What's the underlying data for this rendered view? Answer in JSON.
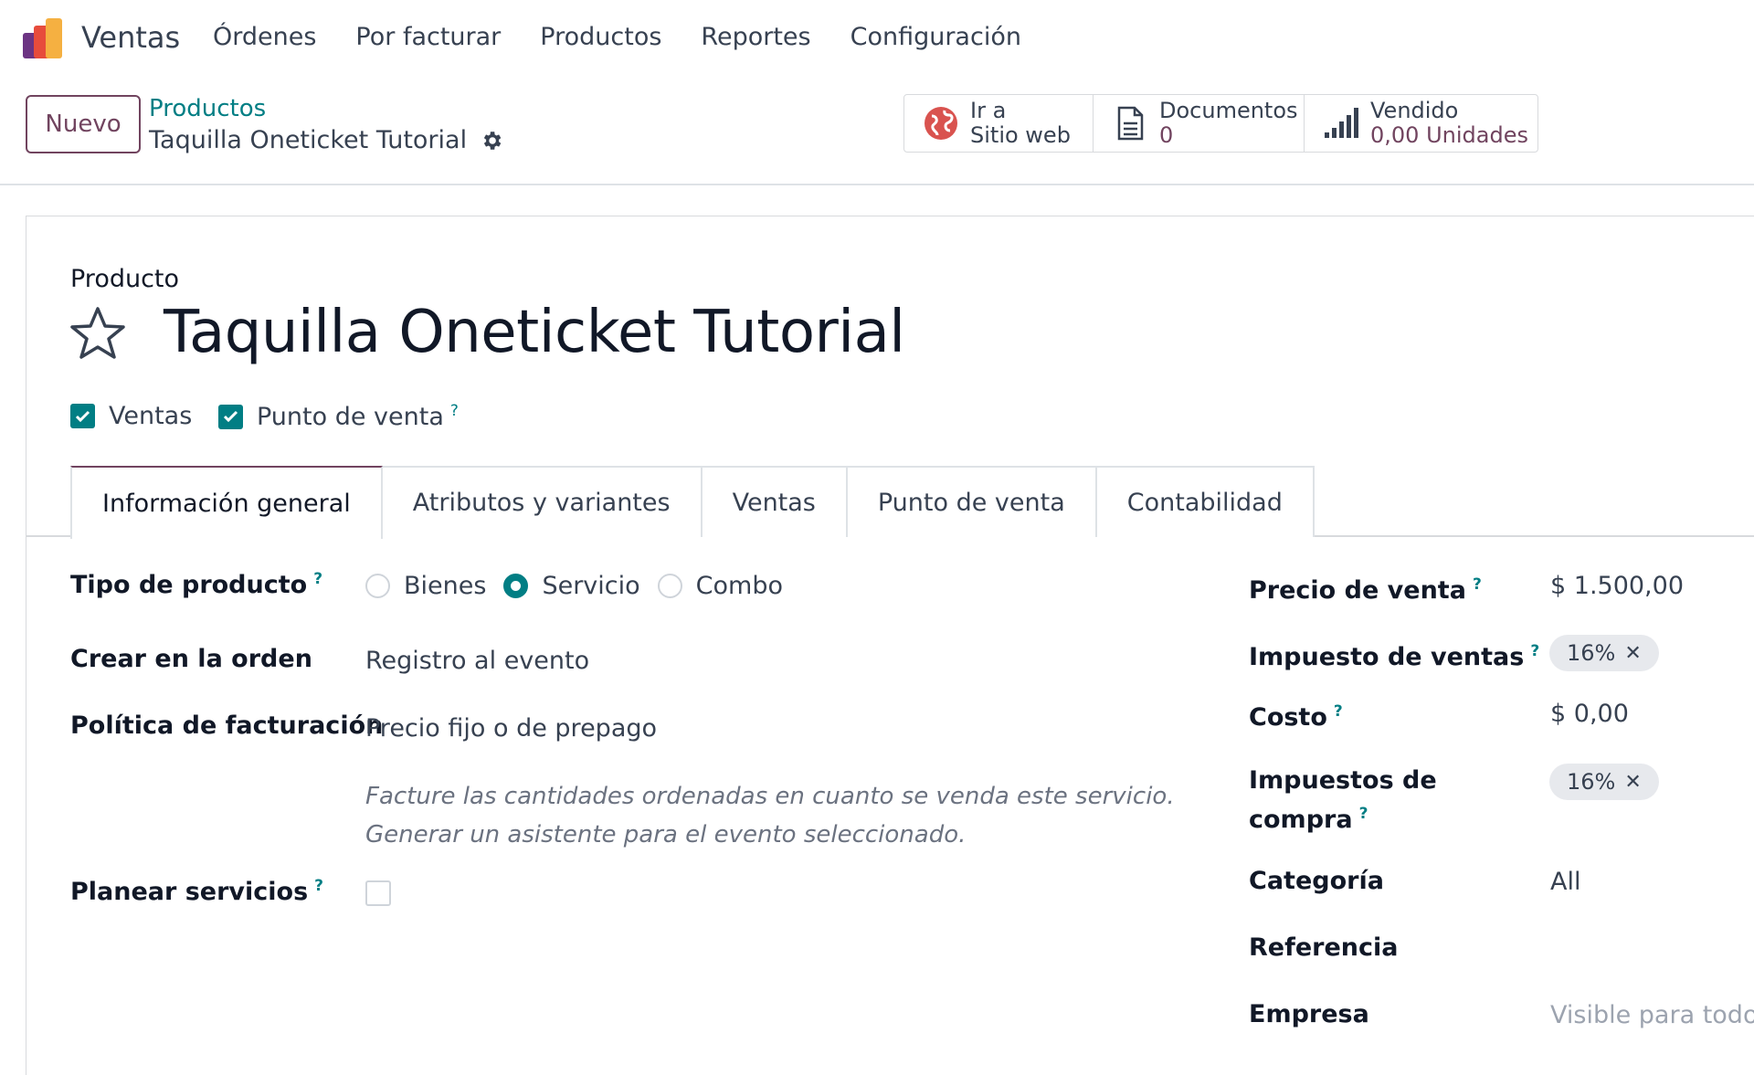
{
  "app": {
    "name": "Ventas"
  },
  "menu": [
    "Órdenes",
    "Por facturar",
    "Productos",
    "Reportes",
    "Configuración"
  ],
  "control": {
    "new_label": "Nuevo",
    "breadcrumb_parent": "Productos",
    "breadcrumb_current": "Taquilla Oneticket Tutorial"
  },
  "smart_buttons": [
    {
      "icon": "globe-icon",
      "line1": "Ir a",
      "line2": "Sitio web"
    },
    {
      "icon": "document-icon",
      "line1": "Documentos",
      "line2": "0"
    },
    {
      "icon": "bar-chart-icon",
      "line1": "Vendido",
      "line2": "0,00 Unidades"
    }
  ],
  "product": {
    "type_label": "Producto",
    "name": "Taquilla Oneticket Tutorial",
    "checkboxes": [
      {
        "label": "Ventas",
        "checked": true,
        "help": ""
      },
      {
        "label": "Punto de venta",
        "checked": true,
        "help": "?"
      }
    ]
  },
  "tabs": [
    "Información general",
    "Atributos y variantes",
    "Ventas",
    "Punto de venta",
    "Contabilidad"
  ],
  "general": {
    "product_type": {
      "label": "Tipo de producto",
      "help": "?",
      "options": [
        "Bienes",
        "Servicio",
        "Combo"
      ],
      "selected": "Servicio"
    },
    "create_on_order": {
      "label": "Crear en la orden",
      "value": "Registro al evento"
    },
    "invoice_policy": {
      "label": "Política de facturación",
      "value": "Precio fijo o de prepago"
    },
    "hint_lines": [
      "Facture las cantidades ordenadas en cuanto se venda este servicio.",
      "Generar un asistente para el evento seleccionado."
    ],
    "plan_services": {
      "label": "Planear servicios",
      "help": "?",
      "checked": false
    }
  },
  "pricing": {
    "sale_price": {
      "label": "Precio de venta",
      "help": "?",
      "value": "$ 1.500,00"
    },
    "sales_tax": {
      "label": "Impuesto de ventas",
      "help": "?",
      "tag": "16%"
    },
    "cost": {
      "label": "Costo",
      "help": "?",
      "value": "$ 0,00"
    },
    "purchase_tax": {
      "label_line1": "Impuestos de",
      "label_line2": "compra",
      "help": "?",
      "tag": "16%"
    },
    "category": {
      "label": "Categoría",
      "value": "All"
    },
    "reference": {
      "label": "Referencia",
      "value": ""
    },
    "company": {
      "label": "Empresa",
      "placeholder": "Visible para todos"
    }
  },
  "colors": {
    "brand": "#71445f",
    "accent": "#017e84",
    "border": "#d8dadd"
  }
}
